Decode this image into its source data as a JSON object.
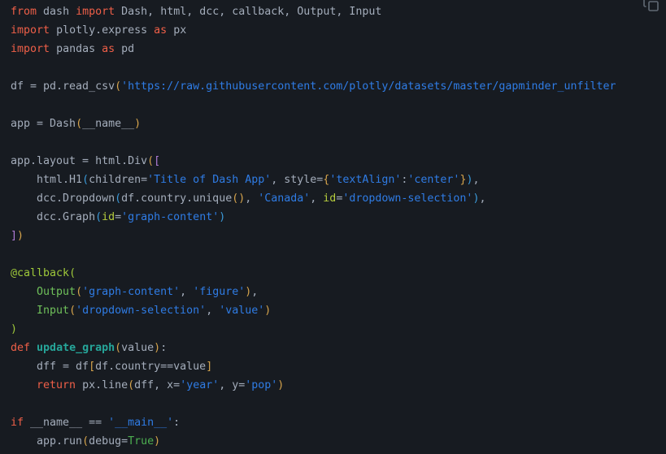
{
  "editor": {
    "kind": "code-block",
    "language": "python",
    "theme": "dark",
    "background_color": "#171b21",
    "default_text_color": "#a4adbb",
    "copy_button": {
      "icon": "copy-icon",
      "tooltip": "Copy"
    }
  },
  "palette": {
    "keyword": "#ef5f48",
    "string": "#2f7ce5",
    "decorator": "#9ec83a",
    "function_call": "#6fc05a",
    "function_def": "#26a69a",
    "keyword_argument": "#b5cc3d",
    "constant": "#4caf50",
    "plain": "#a4adbb"
  },
  "code": {
    "lines": [
      "from dash import Dash, html, dcc, callback, Output, Input",
      "import plotly.express as px",
      "import pandas as pd",
      "",
      "df = pd.read_csv('https://raw.githubusercontent.com/plotly/datasets/master/gapminder_unfilter",
      "",
      "app = Dash(__name__)",
      "",
      "app.layout = html.Div([",
      "    html.H1(children='Title of Dash App', style={'textAlign':'center'}),",
      "    dcc.Dropdown(df.country.unique(), 'Canada', id='dropdown-selection'),",
      "    dcc.Graph(id='graph-content')",
      "])",
      "",
      "@callback(",
      "    Output('graph-content', 'figure'),",
      "    Input('dropdown-selection', 'value')",
      ")",
      "def update_graph(value):",
      "    dff = df[df.country==value]",
      "    return px.line(dff, x='year', y='pop')",
      "",
      "if __name__ == '__main__':",
      "    app.run(debug=True)"
    ],
    "strings": [
      "'https://raw.githubusercontent.com/plotly/datasets/master/gapminder_unfilter",
      "'Title of Dash App'",
      "'textAlign'",
      "'center'",
      "'Canada'",
      "'dropdown-selection'",
      "'graph-content'",
      "'graph-content'",
      "'figure'",
      "'dropdown-selection'",
      "'value'",
      "'year'",
      "'pop'",
      "'__main__'"
    ],
    "keywords": [
      "from",
      "import",
      "as",
      "def",
      "return",
      "if"
    ],
    "identifiers": {
      "dataframe": "df",
      "filtered_dataframe": "dff",
      "app": "app",
      "callback_function": "update_graph",
      "decorator": "@callback",
      "dropdown_id": "dropdown-selection",
      "graph_id": "graph-content",
      "default_country": "Canada",
      "title_text": "Title of Dash App",
      "x_axis_column": "year",
      "y_axis_column": "pop",
      "debug_flag": "True"
    }
  }
}
